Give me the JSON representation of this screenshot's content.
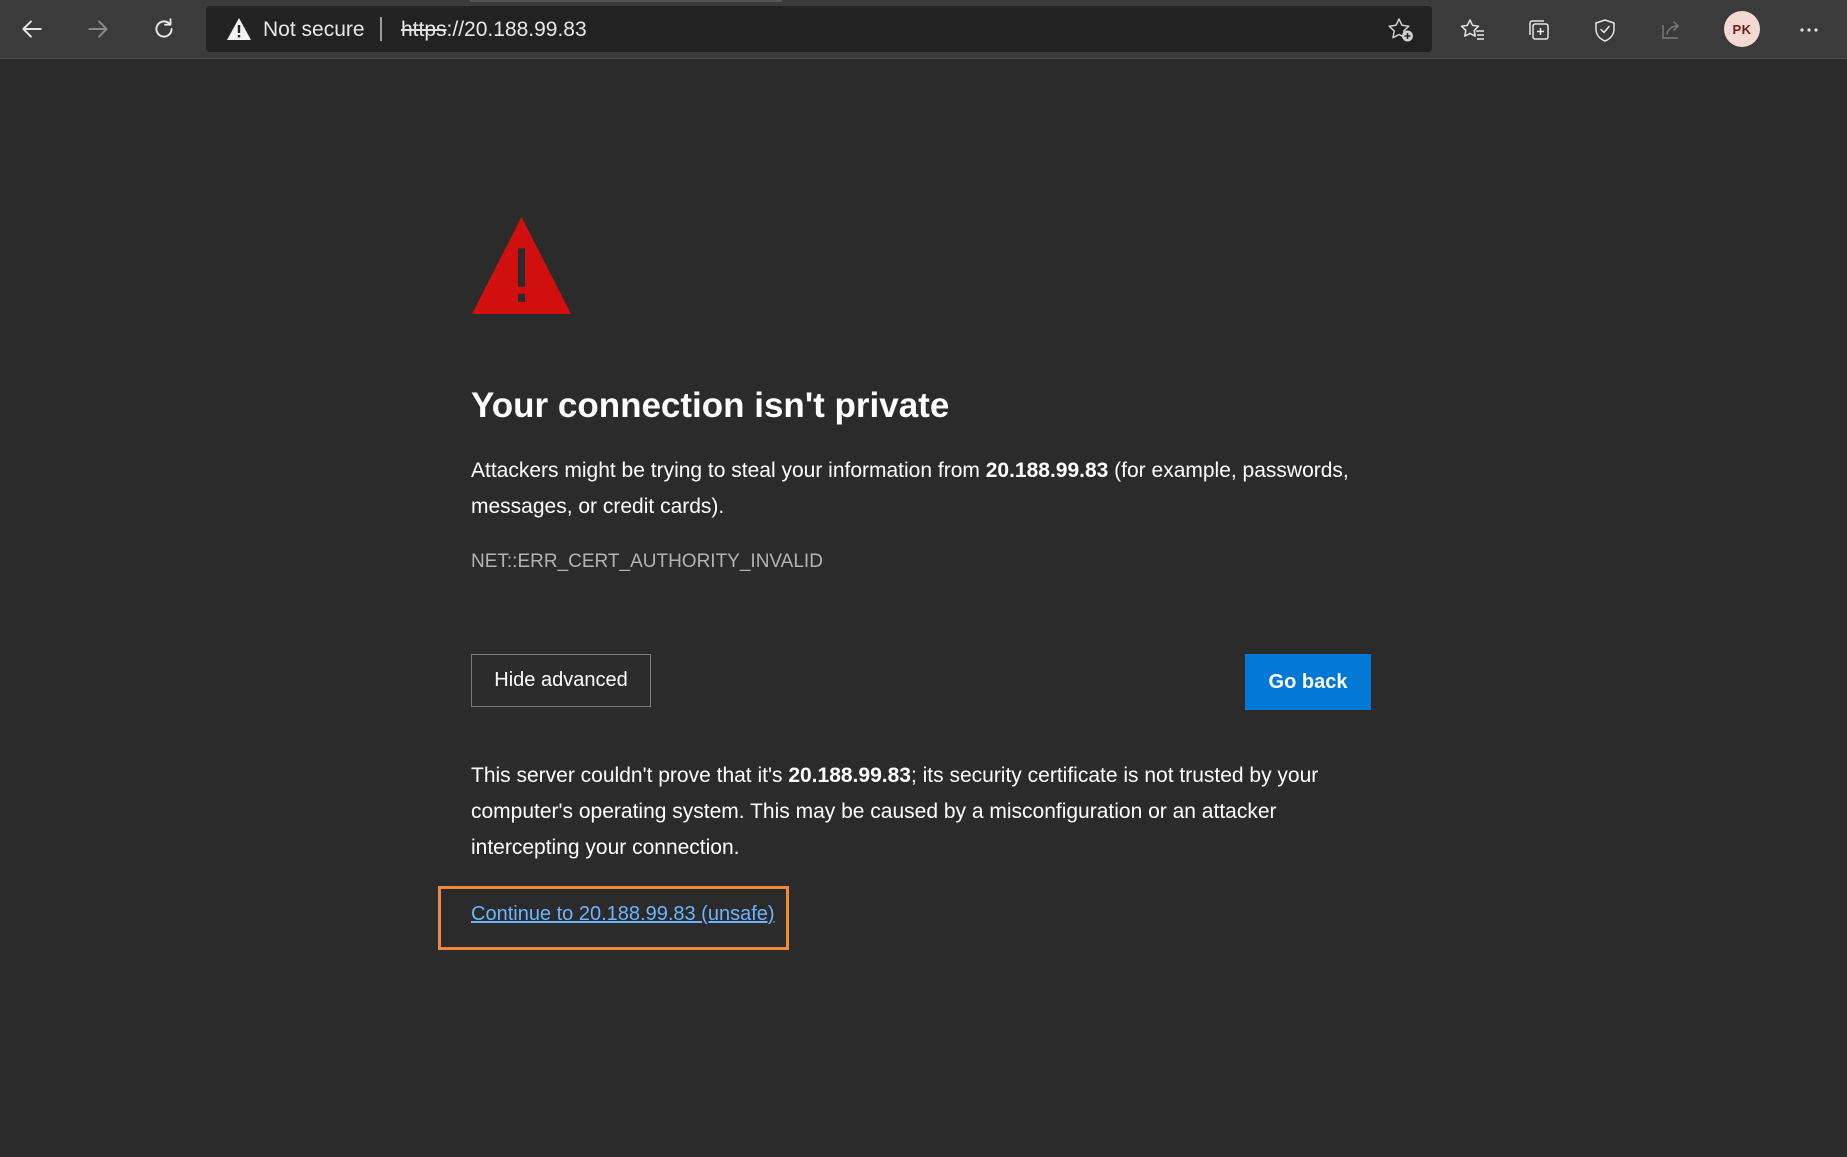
{
  "browser": {
    "address": {
      "security_status": "Not secure",
      "scheme": "https",
      "url_rest": "://20.188.99.83"
    },
    "profile_initials": "PK",
    "icons": {
      "back": "arrow-left-icon",
      "forward": "arrow-right-icon",
      "refresh": "refresh-icon",
      "warning": "warning-triangle-icon",
      "add_favorite": "star-plus-icon",
      "favorites": "favorites-star-list-icon",
      "collections": "collections-icon",
      "browser_essentials": "heart-shield-icon",
      "share": "share-icon",
      "more": "more-dots-icon"
    }
  },
  "page": {
    "title": "Your connection isn't private",
    "intro": {
      "before": "Attackers might be trying to steal your information from ",
      "host": "20.188.99.83",
      "after": " (for example, passwords, messages, or credit cards)."
    },
    "error_code": "NET::ERR_CERT_AUTHORITY_INVALID",
    "hide_advanced_label": "Hide advanced",
    "go_back_label": "Go back",
    "details": {
      "before": "This server couldn't prove that it's ",
      "host": "20.188.99.83",
      "after": "; its security certificate is not trusted by your computer's operating system. This may be caused by a misconfiguration or an attacker intercepting your connection."
    },
    "continue_link": "Continue to 20.188.99.83 (unsafe)"
  },
  "colors": {
    "page_background": "#2b2b2b",
    "toolbar_background": "#3b3b3b",
    "warning_red": "#d20f0f",
    "primary_button": "#0078d4",
    "link": "#6cb4ff",
    "highlight_box": "#f0883e"
  }
}
